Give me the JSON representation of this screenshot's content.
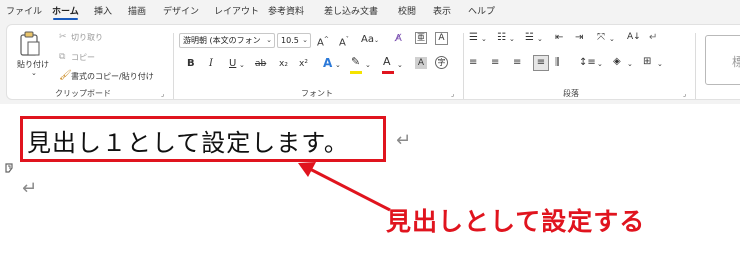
{
  "menu": {
    "tabs": [
      "ファイル",
      "ホーム",
      "挿入",
      "描画",
      "デザイン",
      "レイアウト",
      "参考資料",
      "差し込み文書",
      "校閲",
      "表示",
      "ヘルプ"
    ],
    "active": "ホーム"
  },
  "ribbon": {
    "clipboard": {
      "paste_label": "貼り付け",
      "cut_label": "切り取り",
      "copy_label": "コピー",
      "format_painter_label": "書式のコピー/貼り付け",
      "group_label": "クリップボード"
    },
    "font": {
      "font_name": "游明朝 (本文のフォン",
      "font_size": "10.5",
      "group_label": "フォント",
      "grow_glyph": "A^",
      "shrink_glyph": "A˅",
      "case_glyph": "Aa",
      "bold": "B",
      "italic": "I",
      "underline": "U",
      "strike": "ab",
      "subscript": "x₂",
      "superscript": "x²",
      "highlight_color": "#f5e300",
      "font_color": "#e0141e"
    },
    "paragraph": {
      "group_label": "段落"
    },
    "styles": {
      "preview_label": "標"
    }
  },
  "document": {
    "heading_text": "見出し１として設定します。",
    "paragraph_mark": "↵",
    "highlight_color": "#e0141e"
  },
  "annotation": {
    "callout_text": "見出しとして設定する",
    "color": "#e0141e"
  }
}
